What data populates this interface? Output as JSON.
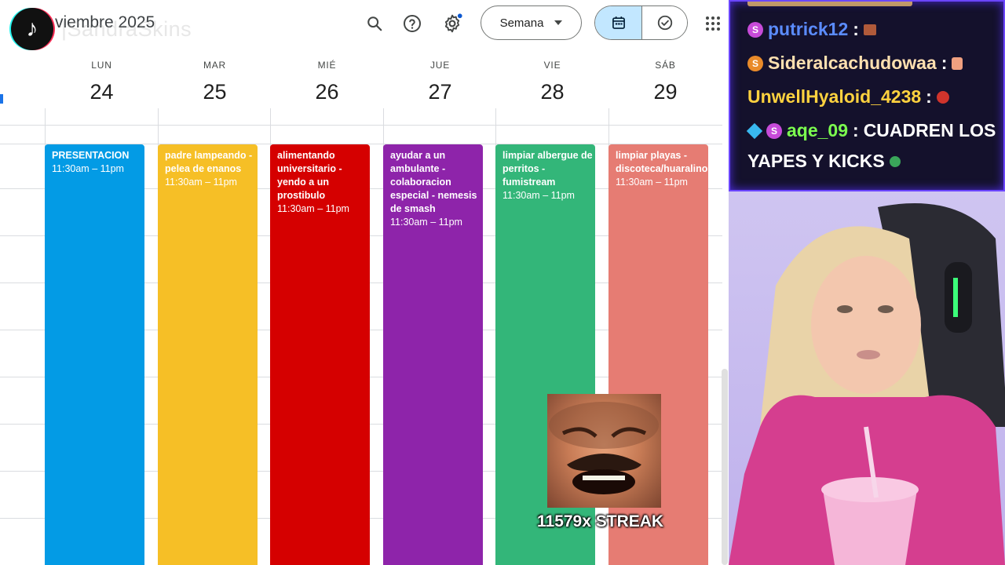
{
  "header": {
    "title": "viembre 2025",
    "watermark": "|SandraSkins",
    "view_label": "Semana"
  },
  "days": [
    {
      "name": "LUN",
      "num": "24"
    },
    {
      "name": "MAR",
      "num": "25"
    },
    {
      "name": "MIÉ",
      "num": "26"
    },
    {
      "name": "JUE",
      "num": "27"
    },
    {
      "name": "VIE",
      "num": "28"
    },
    {
      "name": "SÁB",
      "num": "29"
    }
  ],
  "events": [
    {
      "title": "PRESENTACION",
      "time": "11:30am – 11pm",
      "color": "#039be5",
      "text_color": "#ffffff"
    },
    {
      "title": "padre lampeando - pelea de enanos",
      "time": "11:30am – 11pm",
      "color": "#f6bf26",
      "text_color": "#ffffff"
    },
    {
      "title": "alimentando universitario - yendo a un prostibulo",
      "time": "11:30am – 11pm",
      "color": "#d50000",
      "text_color": "#ffffff"
    },
    {
      "title": "ayudar a un ambulante - colaboracion especial - nemesis de smash",
      "time": "11:30am – 11pm",
      "color": "#8e24aa",
      "text_color": "#ffffff"
    },
    {
      "title": "limpiar albergue de perritos - fumistream",
      "time": "11:30am – 11pm",
      "color": "#33b679",
      "text_color": "#ffffff"
    },
    {
      "title": "limpiar playas - discoteca/huaralino",
      "time": "11:30am – 11pm",
      "color": "#e67c73",
      "text_color": "#ffffff"
    }
  ],
  "chat": {
    "messages": [
      {
        "user": "putrick12",
        "user_color": "#5b8cff",
        "msg": ""
      },
      {
        "user": "Sideralcachudowaa",
        "user_color": "#ffe0b0",
        "msg": ""
      },
      {
        "user": "UnwellHyaloid_4238",
        "user_color": "#ffd23f",
        "msg": ""
      },
      {
        "user": "aqe_09",
        "user_color": "#7cff4f",
        "msg": "CUADREN LOS"
      },
      {
        "user": "",
        "user_color": "#ffffff",
        "msg": "YAPES Y KICKS"
      }
    ]
  },
  "overlay": {
    "streak": "11579x STREAK"
  }
}
